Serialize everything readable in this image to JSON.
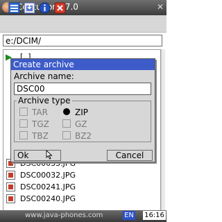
{
  "window": {
    "title": "Centurion v7.0",
    "close_glyph": "✕"
  },
  "toolbar": {
    "icons": [
      "list-view-icon",
      "archive-icon",
      "info-icon",
      "close-icon"
    ]
  },
  "path": {
    "value": "e:/DCIM/"
  },
  "file_list": {
    "parent_label": "[..]",
    "visible_files": [
      "DSC00033.JPG",
      "DSC00032.JPG",
      "DSC00241.JPG",
      "DSC00240.JPG"
    ]
  },
  "dialog": {
    "title": "Create archive",
    "name_label": "Archive name:",
    "name_value": "DSC00",
    "type_label": "Archive type",
    "options": [
      {
        "label": "TAR",
        "kind": "checkbox",
        "checked": false,
        "enabled": false
      },
      {
        "label": "ZIP",
        "kind": "radio",
        "checked": true,
        "enabled": true
      },
      {
        "label": "TGZ",
        "kind": "checkbox",
        "checked": false,
        "enabled": false
      },
      {
        "label": "GZ",
        "kind": "checkbox",
        "checked": false,
        "enabled": false
      },
      {
        "label": "TBZ",
        "kind": "checkbox",
        "checked": false,
        "enabled": false
      },
      {
        "label": "BZ2",
        "kind": "checkbox",
        "checked": false,
        "enabled": false
      }
    ],
    "ok_label": "Ok",
    "cancel_label": "Cancel"
  },
  "statusbar": {
    "watermark": "www.java-phones.com",
    "language": "EN",
    "time": "16:16"
  },
  "colors": {
    "title_bar": "#4a4a4a",
    "dialog_title": "#3d5cc9",
    "lang_badge": "#2c50c8"
  }
}
